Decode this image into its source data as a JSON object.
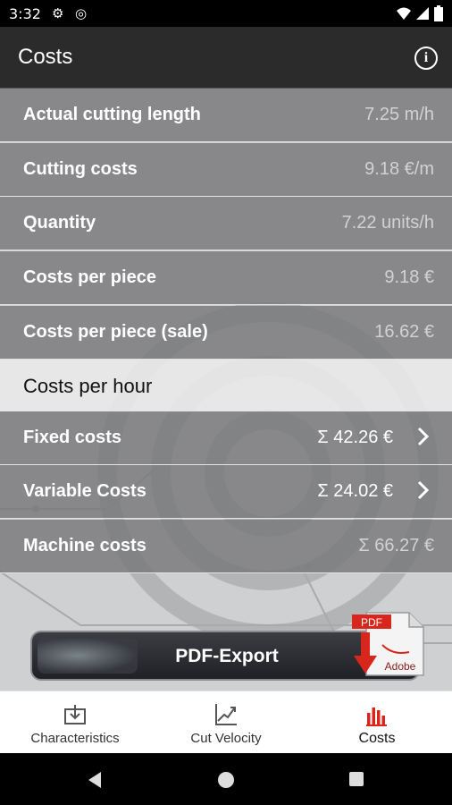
{
  "status_bar": {
    "time": "3:32"
  },
  "app_bar": {
    "title": "Costs",
    "info_icon": "info-icon"
  },
  "cost_rows": [
    {
      "label": "Actual cutting length",
      "value": "7.25 m/h"
    },
    {
      "label": "Cutting costs",
      "value": "9.18 €/m"
    },
    {
      "label": "Quantity",
      "value": "7.22 units/h"
    },
    {
      "label": "Costs per piece",
      "value": "9.18 €"
    },
    {
      "label": "Costs per piece (sale)",
      "value": "16.62 €"
    }
  ],
  "section": {
    "title": "Costs per hour"
  },
  "hour_rows": [
    {
      "label": "Fixed costs",
      "value": "Σ 42.26 €"
    },
    {
      "label": "Variable Costs",
      "value": "Σ 24.02  €"
    },
    {
      "label": "Machine costs",
      "value": "Σ 66.27  €"
    }
  ],
  "pdf_export": {
    "label": "PDF-Export",
    "logo_top": "PDF",
    "logo_brand": "Adobe"
  },
  "bottom_nav": [
    {
      "label": "Characteristics",
      "icon": "download-tray-icon"
    },
    {
      "label": "Cut Velocity",
      "icon": "line-chart-icon"
    },
    {
      "label": "Costs",
      "icon": "bar-chart-icon"
    }
  ],
  "colors": {
    "accent": "#d9261c",
    "row_bg": "#78787a",
    "app_bar": "#2b2b2b"
  }
}
